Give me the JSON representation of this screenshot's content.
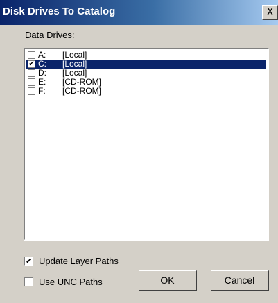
{
  "window": {
    "title": "Disk Drives To Catalog",
    "close_label": "X"
  },
  "drives_group": {
    "label": "Data Drives:",
    "items": [
      {
        "letter": "A:",
        "type": "[Local]",
        "checked": false,
        "selected": false
      },
      {
        "letter": "C:",
        "type": "[Local]",
        "checked": true,
        "selected": true
      },
      {
        "letter": "D:",
        "type": "[Local]",
        "checked": false,
        "selected": false
      },
      {
        "letter": "E:",
        "type": "[CD-ROM]",
        "checked": false,
        "selected": false
      },
      {
        "letter": "F:",
        "type": "[CD-ROM]",
        "checked": false,
        "selected": false
      }
    ]
  },
  "options": {
    "update_layer_paths": {
      "label": "Update Layer Paths",
      "checked": true
    },
    "use_unc_paths": {
      "label": "Use UNC Paths",
      "checked": false
    }
  },
  "buttons": {
    "ok": "OK",
    "cancel": "Cancel"
  },
  "colors": {
    "titlebar_start": "#0a246a",
    "titlebar_end": "#a6caf0",
    "selection": "#0a246a",
    "face": "#d4d0c8"
  }
}
